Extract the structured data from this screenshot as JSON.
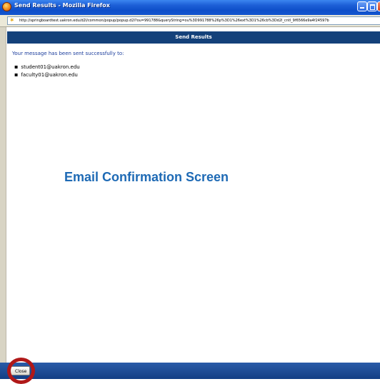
{
  "window": {
    "title": "Send Results - Mozilla Firefox",
    "url": "http://springboardtest.uakron.edu/d2l/common/popup/popup.d2l?ou=991788&queryString=ou%3D991788%26p%3D1%26ext%3D1%26cb%3Dd2l_cntl_9f6566e9a4f24597b"
  },
  "header": {
    "title": "Send Results"
  },
  "content": {
    "message": "Your message has been sent successfully to:",
    "recipients": [
      "student01@uakron.edu",
      "faculty01@uakron.edu"
    ]
  },
  "annotation": {
    "label": "Email Confirmation Screen"
  },
  "footer": {
    "close_label": "Close"
  },
  "colors": {
    "header_bg": "#14417a",
    "message_text": "#1a3c9c",
    "annotation_text": "#1e6ab5",
    "highlight": "#b01818"
  },
  "icons": {
    "browser": "firefox-icon",
    "site": "site-favicon",
    "window_controls": [
      "minimize-icon",
      "maximize-icon",
      "close-window-icon"
    ]
  }
}
